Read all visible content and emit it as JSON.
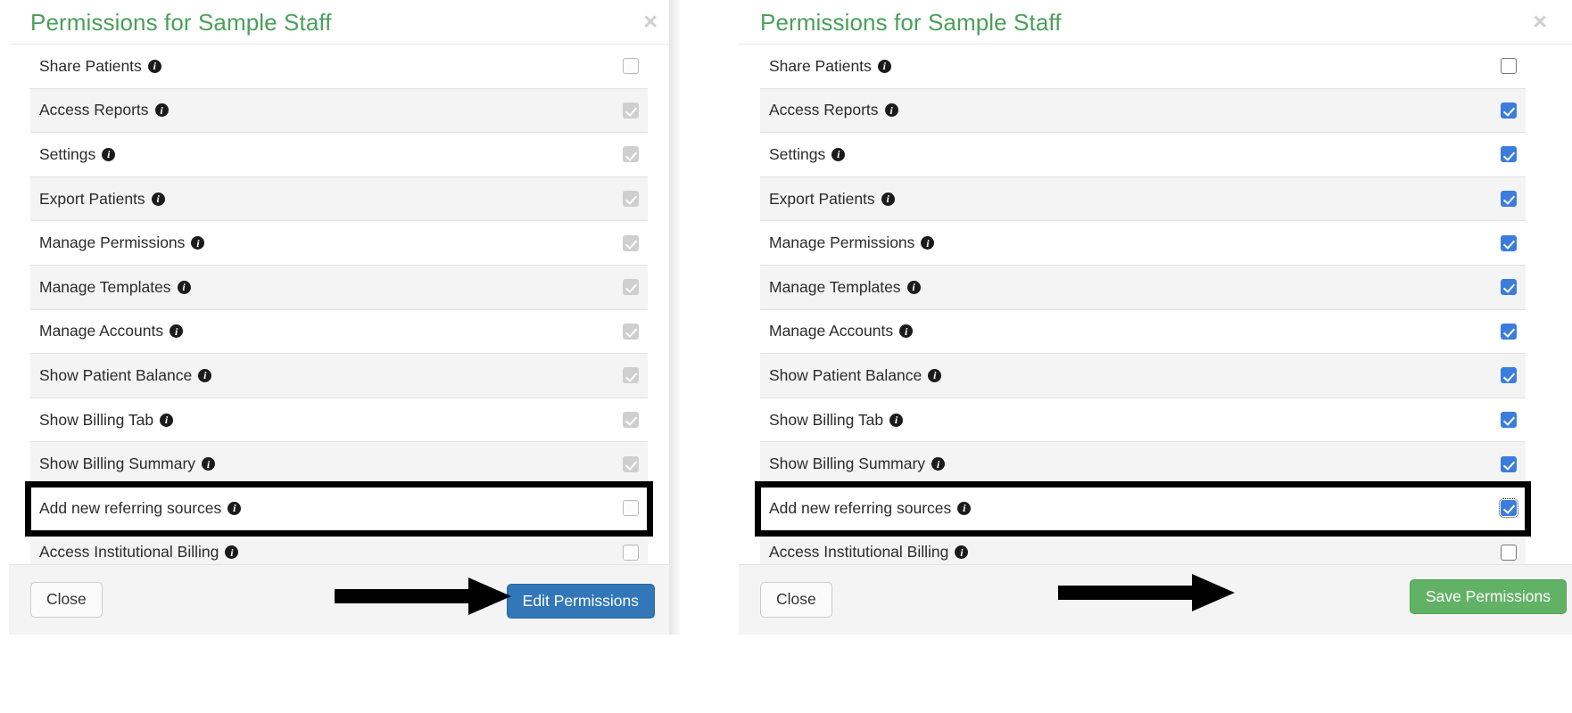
{
  "panels": [
    {
      "id": "left",
      "title": "Permissions for Sample Staff",
      "close_icon": "×",
      "rows": [
        {
          "label": "Share Patients",
          "state": "empty"
        },
        {
          "label": "Access Reports",
          "state": "disabled-checked"
        },
        {
          "label": "Settings",
          "state": "disabled-checked"
        },
        {
          "label": "Export Patients",
          "state": "disabled-checked"
        },
        {
          "label": "Manage Permissions",
          "state": "disabled-checked"
        },
        {
          "label": "Manage Templates",
          "state": "disabled-checked"
        },
        {
          "label": "Manage Accounts",
          "state": "disabled-checked"
        },
        {
          "label": "Show Patient Balance",
          "state": "disabled-checked"
        },
        {
          "label": "Show Billing Tab",
          "state": "disabled-checked"
        },
        {
          "label": "Show Billing Summary",
          "state": "disabled-checked"
        },
        {
          "label": "Add new referring sources",
          "state": "empty",
          "highlighted": true
        },
        {
          "label": "Access Institutional Billing",
          "state": "empty"
        }
      ],
      "footer": {
        "close_label": "Close",
        "action_label": "Edit Permissions",
        "action_style": "primary"
      }
    },
    {
      "id": "right",
      "title": "Permissions for Sample Staff",
      "close_icon": "×",
      "rows": [
        {
          "label": "Share Patients",
          "state": "empty-strong"
        },
        {
          "label": "Access Reports",
          "state": "checked"
        },
        {
          "label": "Settings",
          "state": "checked"
        },
        {
          "label": "Export Patients",
          "state": "checked"
        },
        {
          "label": "Manage Permissions",
          "state": "checked"
        },
        {
          "label": "Manage Templates",
          "state": "checked"
        },
        {
          "label": "Manage Accounts",
          "state": "checked"
        },
        {
          "label": "Show Patient Balance",
          "state": "checked"
        },
        {
          "label": "Show Billing Tab",
          "state": "checked"
        },
        {
          "label": "Show Billing Summary",
          "state": "checked"
        },
        {
          "label": "Add new referring sources",
          "state": "checked-focus",
          "highlighted": true
        },
        {
          "label": "Access Institutional Billing",
          "state": "empty-strong"
        }
      ],
      "footer": {
        "close_label": "Close",
        "action_label": "Save Permissions",
        "action_style": "success"
      }
    }
  ],
  "annotations": {
    "arrow_left_target": "Edit Permissions",
    "arrow_right_target": "Save Permissions"
  },
  "colors": {
    "title_green": "#4a9f5b",
    "primary_blue": "#3277b8",
    "success_green": "#62b265",
    "checkbox_blue": "#3b7ddd",
    "checkbox_disabled": "#cfcfcf",
    "row_stripe": "#f4f4f4",
    "annotation_black": "#000000"
  }
}
